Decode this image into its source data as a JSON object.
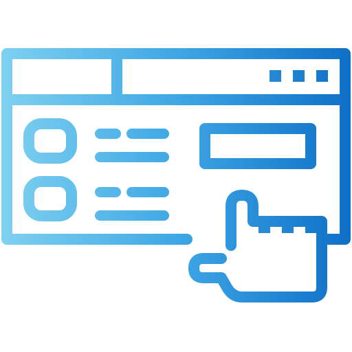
{
  "icon": {
    "name": "web-page-click-icon",
    "description_of_parts": [
      "browser-window",
      "window-control-dots",
      "list-item-checkbox",
      "list-item-lines",
      "button-outline",
      "pointing-hand"
    ],
    "colors": {
      "gradient_start": "#7FD1F0",
      "gradient_mid": "#3FA7E5",
      "gradient_end": "#0F6FC6",
      "background": "#FFFFFF"
    }
  }
}
